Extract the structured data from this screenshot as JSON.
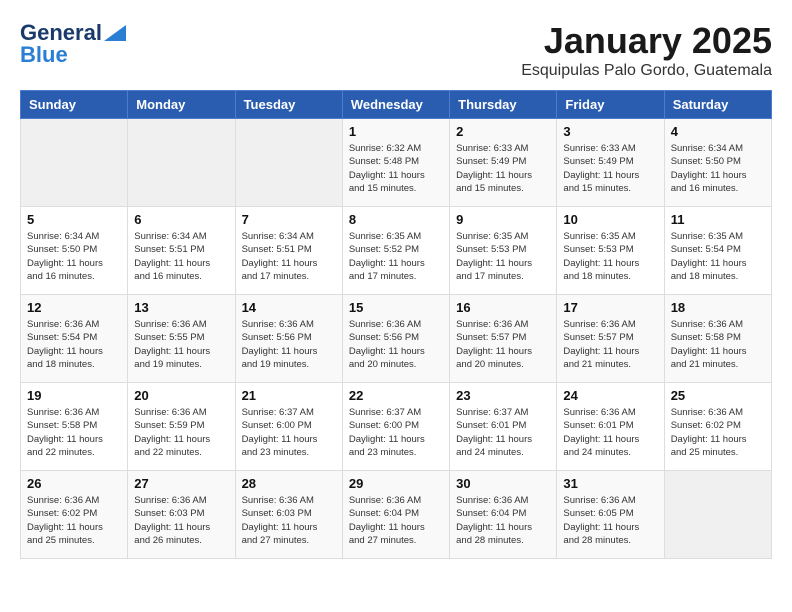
{
  "logo": {
    "line1": "General",
    "line2": "Blue"
  },
  "title": "January 2025",
  "location": "Esquipulas Palo Gordo, Guatemala",
  "weekdays": [
    "Sunday",
    "Monday",
    "Tuesday",
    "Wednesday",
    "Thursday",
    "Friday",
    "Saturday"
  ],
  "weeks": [
    [
      {
        "day": "",
        "info": ""
      },
      {
        "day": "",
        "info": ""
      },
      {
        "day": "",
        "info": ""
      },
      {
        "day": "1",
        "info": "Sunrise: 6:32 AM\nSunset: 5:48 PM\nDaylight: 11 hours\nand 15 minutes."
      },
      {
        "day": "2",
        "info": "Sunrise: 6:33 AM\nSunset: 5:49 PM\nDaylight: 11 hours\nand 15 minutes."
      },
      {
        "day": "3",
        "info": "Sunrise: 6:33 AM\nSunset: 5:49 PM\nDaylight: 11 hours\nand 15 minutes."
      },
      {
        "day": "4",
        "info": "Sunrise: 6:34 AM\nSunset: 5:50 PM\nDaylight: 11 hours\nand 16 minutes."
      }
    ],
    [
      {
        "day": "5",
        "info": "Sunrise: 6:34 AM\nSunset: 5:50 PM\nDaylight: 11 hours\nand 16 minutes."
      },
      {
        "day": "6",
        "info": "Sunrise: 6:34 AM\nSunset: 5:51 PM\nDaylight: 11 hours\nand 16 minutes."
      },
      {
        "day": "7",
        "info": "Sunrise: 6:34 AM\nSunset: 5:51 PM\nDaylight: 11 hours\nand 17 minutes."
      },
      {
        "day": "8",
        "info": "Sunrise: 6:35 AM\nSunset: 5:52 PM\nDaylight: 11 hours\nand 17 minutes."
      },
      {
        "day": "9",
        "info": "Sunrise: 6:35 AM\nSunset: 5:53 PM\nDaylight: 11 hours\nand 17 minutes."
      },
      {
        "day": "10",
        "info": "Sunrise: 6:35 AM\nSunset: 5:53 PM\nDaylight: 11 hours\nand 18 minutes."
      },
      {
        "day": "11",
        "info": "Sunrise: 6:35 AM\nSunset: 5:54 PM\nDaylight: 11 hours\nand 18 minutes."
      }
    ],
    [
      {
        "day": "12",
        "info": "Sunrise: 6:36 AM\nSunset: 5:54 PM\nDaylight: 11 hours\nand 18 minutes."
      },
      {
        "day": "13",
        "info": "Sunrise: 6:36 AM\nSunset: 5:55 PM\nDaylight: 11 hours\nand 19 minutes."
      },
      {
        "day": "14",
        "info": "Sunrise: 6:36 AM\nSunset: 5:56 PM\nDaylight: 11 hours\nand 19 minutes."
      },
      {
        "day": "15",
        "info": "Sunrise: 6:36 AM\nSunset: 5:56 PM\nDaylight: 11 hours\nand 20 minutes."
      },
      {
        "day": "16",
        "info": "Sunrise: 6:36 AM\nSunset: 5:57 PM\nDaylight: 11 hours\nand 20 minutes."
      },
      {
        "day": "17",
        "info": "Sunrise: 6:36 AM\nSunset: 5:57 PM\nDaylight: 11 hours\nand 21 minutes."
      },
      {
        "day": "18",
        "info": "Sunrise: 6:36 AM\nSunset: 5:58 PM\nDaylight: 11 hours\nand 21 minutes."
      }
    ],
    [
      {
        "day": "19",
        "info": "Sunrise: 6:36 AM\nSunset: 5:58 PM\nDaylight: 11 hours\nand 22 minutes."
      },
      {
        "day": "20",
        "info": "Sunrise: 6:36 AM\nSunset: 5:59 PM\nDaylight: 11 hours\nand 22 minutes."
      },
      {
        "day": "21",
        "info": "Sunrise: 6:37 AM\nSunset: 6:00 PM\nDaylight: 11 hours\nand 23 minutes."
      },
      {
        "day": "22",
        "info": "Sunrise: 6:37 AM\nSunset: 6:00 PM\nDaylight: 11 hours\nand 23 minutes."
      },
      {
        "day": "23",
        "info": "Sunrise: 6:37 AM\nSunset: 6:01 PM\nDaylight: 11 hours\nand 24 minutes."
      },
      {
        "day": "24",
        "info": "Sunrise: 6:36 AM\nSunset: 6:01 PM\nDaylight: 11 hours\nand 24 minutes."
      },
      {
        "day": "25",
        "info": "Sunrise: 6:36 AM\nSunset: 6:02 PM\nDaylight: 11 hours\nand 25 minutes."
      }
    ],
    [
      {
        "day": "26",
        "info": "Sunrise: 6:36 AM\nSunset: 6:02 PM\nDaylight: 11 hours\nand 25 minutes."
      },
      {
        "day": "27",
        "info": "Sunrise: 6:36 AM\nSunset: 6:03 PM\nDaylight: 11 hours\nand 26 minutes."
      },
      {
        "day": "28",
        "info": "Sunrise: 6:36 AM\nSunset: 6:03 PM\nDaylight: 11 hours\nand 27 minutes."
      },
      {
        "day": "29",
        "info": "Sunrise: 6:36 AM\nSunset: 6:04 PM\nDaylight: 11 hours\nand 27 minutes."
      },
      {
        "day": "30",
        "info": "Sunrise: 6:36 AM\nSunset: 6:04 PM\nDaylight: 11 hours\nand 28 minutes."
      },
      {
        "day": "31",
        "info": "Sunrise: 6:36 AM\nSunset: 6:05 PM\nDaylight: 11 hours\nand 28 minutes."
      },
      {
        "day": "",
        "info": ""
      }
    ]
  ]
}
